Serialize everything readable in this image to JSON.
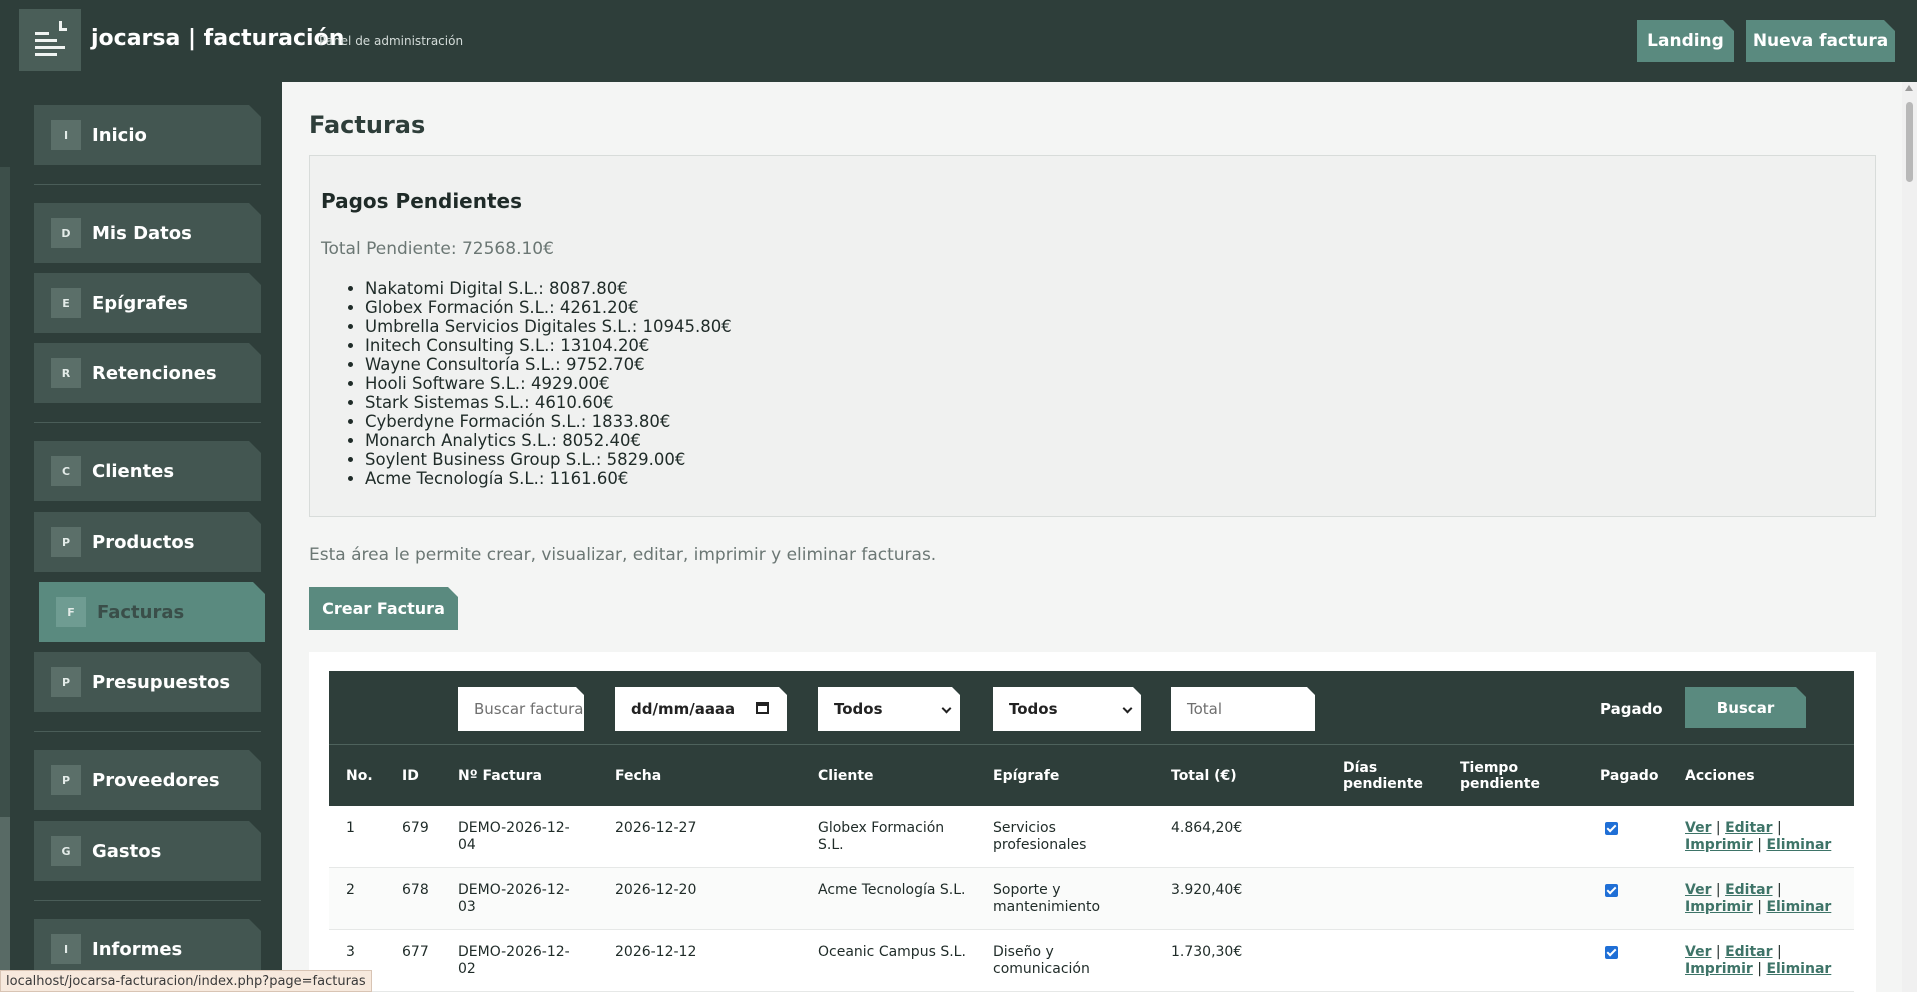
{
  "header": {
    "brand": "jocarsa | facturación",
    "subtitle": "Panel de administración",
    "buttons": {
      "landing": "Landing",
      "nueva": "Nueva factura"
    }
  },
  "sidebar": {
    "items": [
      {
        "badge": "I",
        "label": "Inicio"
      },
      {
        "badge": "D",
        "label": "Mis Datos"
      },
      {
        "badge": "E",
        "label": "Epígrafes"
      },
      {
        "badge": "R",
        "label": "Retenciones"
      },
      {
        "badge": "C",
        "label": "Clientes"
      },
      {
        "badge": "P",
        "label": "Productos"
      },
      {
        "badge": "F",
        "label": "Facturas"
      },
      {
        "badge": "P",
        "label": "Presupuestos"
      },
      {
        "badge": "P",
        "label": "Proveedores"
      },
      {
        "badge": "G",
        "label": "Gastos"
      },
      {
        "badge": "I",
        "label": "Informes"
      }
    ],
    "active": "Facturas"
  },
  "page": {
    "title": "Facturas",
    "pending": {
      "title": "Pagos Pendientes",
      "total": "Total Pendiente: 72568.10€",
      "items": [
        "Nakatomi Digital S.L.: 8087.80€",
        "Globex Formación S.L.: 4261.20€",
        "Umbrella Servicios Digitales S.L.: 10945.80€",
        "Initech Consulting S.L.: 13104.20€",
        "Wayne Consultoría S.L.: 9752.70€",
        "Hooli Software S.L.: 4929.00€",
        "Stark Sistemas S.L.: 4610.60€",
        "Cyberdyne Formación S.L.: 1833.80€",
        "Monarch Analytics S.L.: 8052.40€",
        "Soylent Business Group S.L.: 5829.00€",
        "Acme Tecnología S.L.: 1161.60€"
      ]
    },
    "intro": "Esta área le permite crear, visualizar, editar, imprimir y eliminar facturas.",
    "create_button": "Crear Factura"
  },
  "filters": {
    "search_placeholder": "Buscar factura",
    "date_placeholder": "dd/mm/aaaa",
    "cliente_value": "Todos",
    "epigrafe_value": "Todos",
    "total_placeholder": "Total",
    "pagado_label": "Pagado",
    "search_button": "Buscar"
  },
  "table": {
    "headers": {
      "no": "No.",
      "id": "ID",
      "nfactura": "Nº Factura",
      "fecha": "Fecha",
      "cliente": "Cliente",
      "epigrafe": "Epígrafe",
      "total": "Total (€)",
      "dias": "Días pendiente",
      "tiempo": "Tiempo pendiente",
      "pagado": "Pagado",
      "acciones": "Acciones"
    },
    "rows": [
      {
        "no": "1",
        "id": "679",
        "nfactura": "DEMO-2026-12-04",
        "fecha": "2026-12-27",
        "cliente": "Globex Formación S.L.",
        "epigrafe": "Servicios profesionales",
        "total": "4.864,20€",
        "dias": "",
        "tiempo": "",
        "pagado": true
      },
      {
        "no": "2",
        "id": "678",
        "nfactura": "DEMO-2026-12-03",
        "fecha": "2026-12-20",
        "cliente": "Acme Tecnología S.L.",
        "epigrafe": "Soporte y mantenimiento",
        "total": "3.920,40€",
        "dias": "",
        "tiempo": "",
        "pagado": true
      },
      {
        "no": "3",
        "id": "677",
        "nfactura": "DEMO-2026-12-02",
        "fecha": "2026-12-12",
        "cliente": "Oceanic Campus S.L.",
        "epigrafe": "Diseño y comunicación",
        "total": "1.730,30€",
        "dias": "",
        "tiempo": "",
        "pagado": true
      }
    ],
    "actions": {
      "ver": "Ver",
      "editar": "Editar",
      "imprimir": "Imprimir",
      "eliminar": "Eliminar",
      "sep": "|"
    }
  },
  "status_url": "localhost/jocarsa-facturacion/index.php?page=facturas"
}
